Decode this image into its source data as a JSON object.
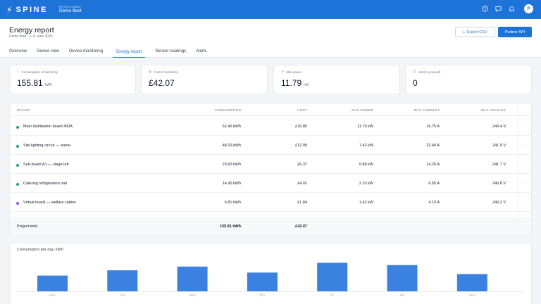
{
  "app": {
    "logo_text": "SPINE",
    "project_label": "PETRA GRANT",
    "project_name": "Demo fleet",
    "avatar": "P"
  },
  "header": {
    "title": "Energy report",
    "subtitle": "Demo fleet · 1–8 June 2026",
    "export_label": "Export CSV",
    "api_label": "Partner API"
  },
  "tabs": [
    {
      "label": "Overview"
    },
    {
      "label": "Device view"
    },
    {
      "label": "Device monitoring"
    },
    {
      "label": "Energy report"
    },
    {
      "label": "Sensor readings"
    },
    {
      "label": "Alerts"
    }
  ],
  "active_tab": "Energy report",
  "kpis": [
    {
      "label": "Consumption of electricity",
      "value": "155.81",
      "unit": "kWh",
      "icon": "bolt-icon",
      "color": "#f5b400"
    },
    {
      "label": "Cost of electricity",
      "value": "£42.07",
      "unit": "",
      "icon": "coin-icon",
      "color": "#22a565"
    },
    {
      "label": "Max power",
      "value": "11.79",
      "unit": "kW",
      "icon": "trend-icon",
      "color": "#22a565"
    },
    {
      "label": "Alerts (x period)",
      "value": "0",
      "unit": "",
      "icon": "warning-icon",
      "color": "#e5484d"
    }
  ],
  "table": {
    "headers": {
      "device": "DEVICE",
      "consumption": "CONSUMPTION",
      "cost": "COST",
      "max_power": "MAX POWER",
      "max_current": "MAX CURRENT",
      "max_voltage": "MAX VOLTAGE"
    },
    "rows": [
      {
        "device": "Main distribution board 400A",
        "consumption": "62.40 kWh",
        "cost": "£16.85",
        "max_power": "11.79 kW",
        "max_current": "16.75 A",
        "max_voltage": "243.4 V",
        "status_color": "#22a565"
      },
      {
        "device": "Site lighting circuit — arena",
        "consumption": "48.10 kWh",
        "cost": "£12.99",
        "max_power": "7.42 kW",
        "max_current": "22.40 A",
        "max_voltage": "241.9 V",
        "status_color": "#22a565"
      },
      {
        "device": "Sub-board A1 — stage left",
        "consumption": "23.60 kWh",
        "cost": "£6.37",
        "max_power": "5.88 kW",
        "max_current": "14.20 A",
        "max_voltage": "241.7 V",
        "status_color": "#22a565"
      },
      {
        "device": "Catering refrigeration unit",
        "consumption": "14.90 kWh",
        "cost": "£4.02",
        "max_power": "2.10 kW",
        "max_current": "6.55 A",
        "max_voltage": "240.8 V",
        "status_color": "#22a565"
      },
      {
        "device": "Virtual board — welfare cabins",
        "consumption": "6.81 kWh",
        "cost": "£1.84",
        "max_power": "1.42 kW",
        "max_current": "4.10 A",
        "max_voltage": "240.2 V",
        "status_color": "#8b5cf6"
      }
    ],
    "total": {
      "label": "Project total",
      "consumption": "155.81 kWh",
      "cost": "£42.07"
    }
  },
  "chart_data": {
    "type": "bar",
    "title": "Consumption per day, kWh",
    "categories": [
      "Mon",
      "Tue",
      "Wed",
      "Thu",
      "Fri",
      "Sat",
      "Sun"
    ],
    "values": [
      21,
      28,
      33,
      25,
      38,
      35,
      23
    ],
    "ylim": [
      0,
      45
    ],
    "grid": false,
    "bar_color": "#3b82e0"
  }
}
